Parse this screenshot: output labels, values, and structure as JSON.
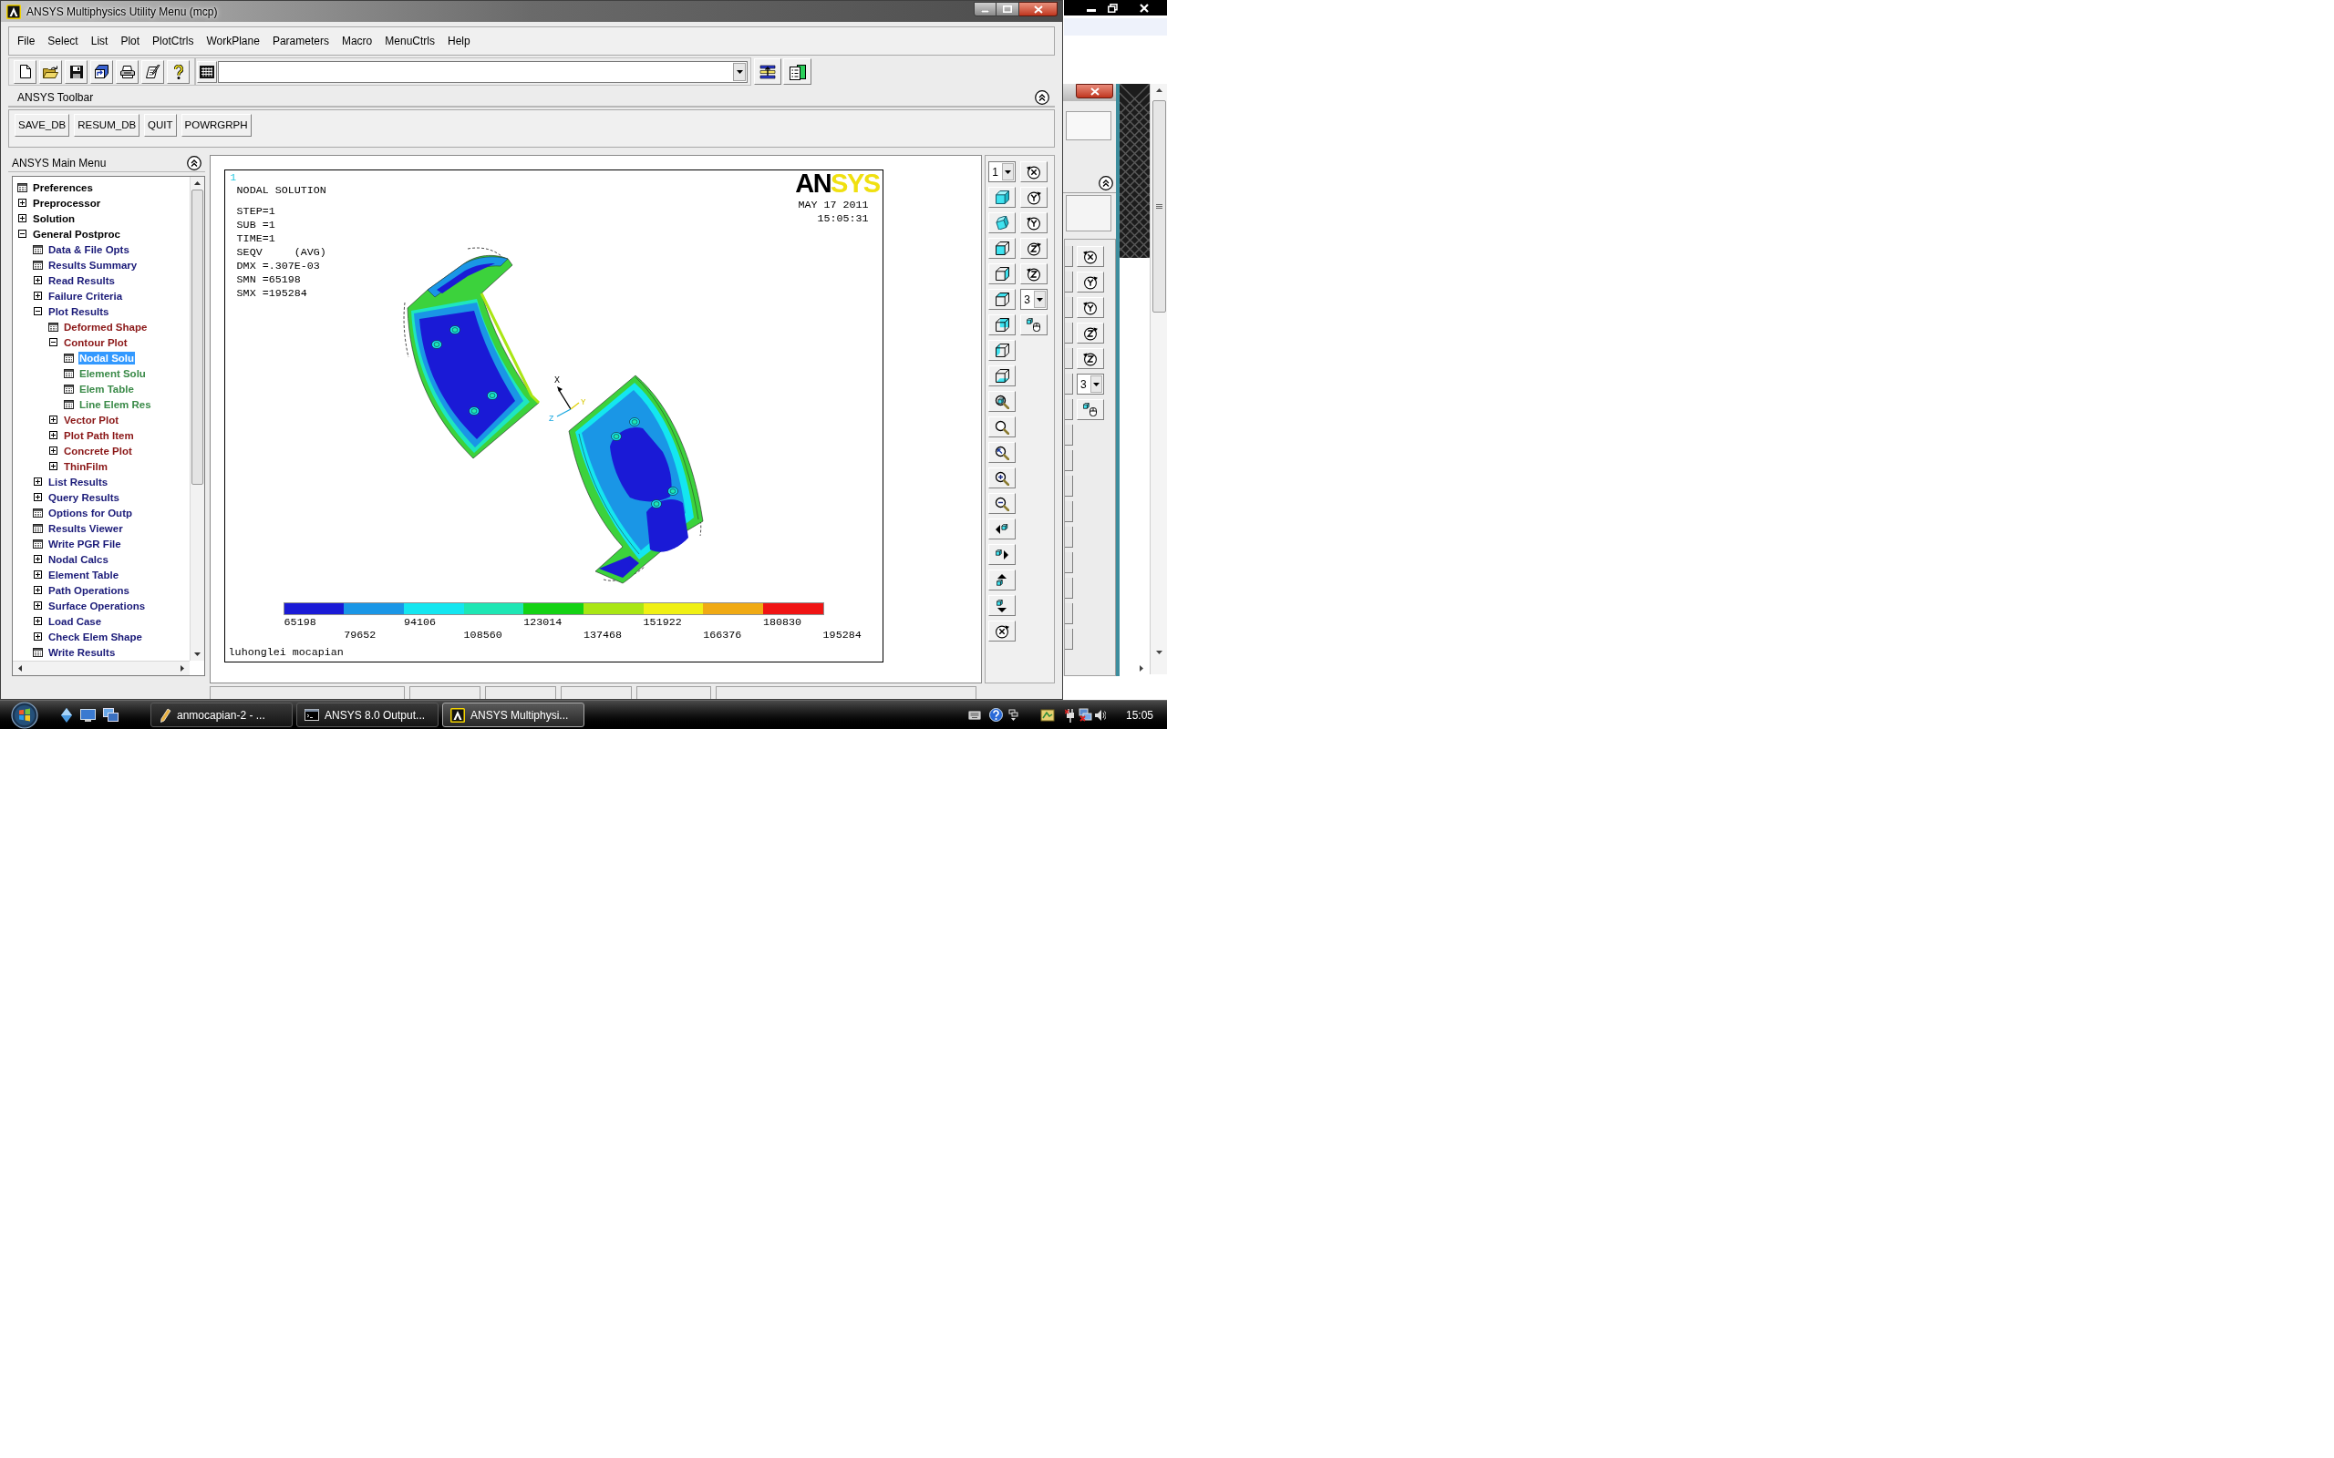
{
  "window": {
    "title": "ANSYS Multiphysics Utility Menu (mcp)"
  },
  "menu_bar": [
    "File",
    "Select",
    "List",
    "Plot",
    "PlotCtrls",
    "WorkPlane",
    "Parameters",
    "Macro",
    "MenuCtrls",
    "Help"
  ],
  "toolbar": {
    "title": "ANSYS Toolbar",
    "buttons": [
      "SAVE_DB",
      "RESUM_DB",
      "QUIT",
      "POWRGRPH"
    ]
  },
  "main_menu": {
    "title": "ANSYS Main Menu",
    "items": [
      {
        "label": "Preferences",
        "kind": "dialog",
        "selected": false
      },
      {
        "label": "Preprocessor",
        "kind": "folder",
        "expanded": false,
        "selected": false
      },
      {
        "label": "Solution",
        "kind": "folder",
        "expanded": false,
        "selected": false
      },
      {
        "label": "General Postproc",
        "kind": "folder",
        "expanded": true,
        "selected": false,
        "children": [
          {
            "label": "Data & File Opts",
            "kind": "dialog",
            "selected": false
          },
          {
            "label": "Results Summary",
            "kind": "dialog",
            "selected": false
          },
          {
            "label": "Read Results",
            "kind": "folder",
            "expanded": false,
            "selected": false
          },
          {
            "label": "Failure Criteria",
            "kind": "folder",
            "expanded": false,
            "selected": false
          },
          {
            "label": "Plot Results",
            "kind": "folder",
            "expanded": true,
            "selected": false,
            "children": [
              {
                "label": "Deformed Shape",
                "kind": "dialog",
                "selected": false
              },
              {
                "label": "Contour Plot",
                "kind": "folder",
                "expanded": true,
                "selected": false,
                "children": [
                  {
                    "label": "Nodal Solu",
                    "kind": "dialog",
                    "selected": true
                  },
                  {
                    "label": "Element Solu",
                    "kind": "dialog",
                    "selected": false
                  },
                  {
                    "label": "Elem Table",
                    "kind": "dialog",
                    "selected": false
                  },
                  {
                    "label": "Line Elem Res",
                    "kind": "dialog",
                    "selected": false
                  }
                ]
              },
              {
                "label": "Vector Plot",
                "kind": "folder",
                "expanded": false,
                "selected": false
              },
              {
                "label": "Plot Path Item",
                "kind": "folder",
                "expanded": false,
                "selected": false
              },
              {
                "label": "Concrete Plot",
                "kind": "folder",
                "expanded": false,
                "selected": false
              },
              {
                "label": "ThinFilm",
                "kind": "folder",
                "expanded": false,
                "selected": false
              }
            ]
          },
          {
            "label": "List Results",
            "kind": "folder",
            "expanded": false,
            "selected": false
          },
          {
            "label": "Query Results",
            "kind": "folder",
            "expanded": false,
            "selected": false
          },
          {
            "label": "Options for Outp",
            "kind": "dialog",
            "selected": false
          },
          {
            "label": "Results Viewer",
            "kind": "dialog",
            "selected": false
          },
          {
            "label": "Write PGR File",
            "kind": "dialog",
            "selected": false
          },
          {
            "label": "Nodal Calcs",
            "kind": "folder",
            "expanded": false,
            "selected": false
          },
          {
            "label": "Element Table",
            "kind": "folder",
            "expanded": false,
            "selected": false
          },
          {
            "label": "Path Operations",
            "kind": "folder",
            "expanded": false,
            "selected": false
          },
          {
            "label": "Surface Operations",
            "kind": "folder",
            "expanded": false,
            "selected": false
          },
          {
            "label": "Load Case",
            "kind": "folder",
            "expanded": false,
            "selected": false
          },
          {
            "label": "Check Elem Shape",
            "kind": "folder",
            "expanded": false,
            "selected": false
          },
          {
            "label": "Write Results",
            "kind": "dialog",
            "selected": false
          }
        ]
      }
    ]
  },
  "graphics": {
    "window_number": "1",
    "title": "NODAL SOLUTION",
    "info": [
      "STEP=1",
      "SUB =1",
      "TIME=1",
      "SEQV     (AVG)",
      "DMX =.307E-03",
      "SMN =65198",
      "SMX =195284"
    ],
    "logo_parts": [
      "AN",
      "SYS"
    ],
    "date": "MAY 17 2011",
    "time": "15:05:31",
    "triad_labels": [
      "X",
      "Y",
      "Z"
    ],
    "legend": {
      "bands": [
        {
          "color": "#1a1ad6"
        },
        {
          "color": "#1a96e6"
        },
        {
          "color": "#14e6f0"
        },
        {
          "color": "#1ee6b4"
        },
        {
          "color": "#14d214"
        },
        {
          "color": "#aae614"
        },
        {
          "color": "#f0f014"
        },
        {
          "color": "#f0aa14"
        },
        {
          "color": "#f01414"
        }
      ],
      "labels": [
        "65198",
        "79652",
        "94106",
        "108560",
        "123014",
        "137468",
        "151922",
        "166376",
        "180830",
        "195284"
      ]
    },
    "caption": "luhonglei mocapian"
  },
  "view_toolbar": {
    "window_select": "1",
    "rate_select": "3"
  },
  "background_window": {
    "rate_select": "3"
  },
  "taskbar": {
    "tasks": [
      {
        "label": "anmocapian-2 - ...",
        "selected": false
      },
      {
        "label": "ANSYS 8.0 Output...",
        "selected": false
      },
      {
        "label": "ANSYS Multiphysi...",
        "selected": true
      }
    ],
    "clock": "15:05"
  }
}
